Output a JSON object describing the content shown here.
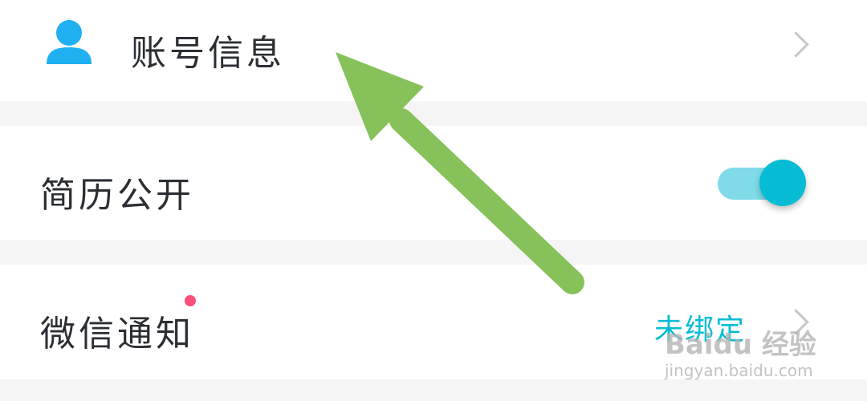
{
  "colors": {
    "accent": "#06bcd4",
    "toggle_track": "#7fdbe8",
    "badge": "#ff4f7b",
    "arrow": "#86c15a",
    "separator": "#f5f5f5"
  },
  "account_row": {
    "icon": "user-icon",
    "label": "账号信息",
    "chevron": "chevron-right-icon"
  },
  "resume_row": {
    "label": "简历公开",
    "toggle_on": true
  },
  "wechat_row": {
    "label": "微信通知",
    "badge": true,
    "status": "未绑定",
    "chevron": "chevron-right-icon"
  },
  "watermark": {
    "brand": "Baidu 经验",
    "url": "jingyan.baidu.com"
  }
}
